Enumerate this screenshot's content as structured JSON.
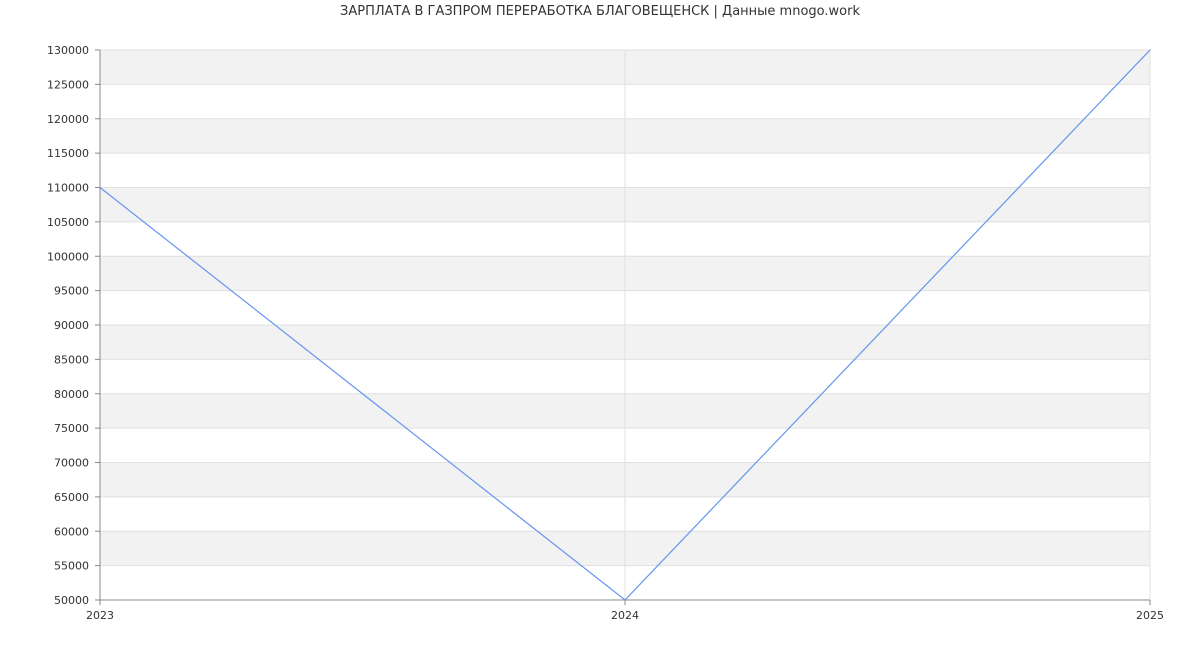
{
  "chart_data": {
    "type": "line",
    "title": "ЗАРПЛАТА В ГАЗПРОМ ПЕРЕРАБОТКА БЛАГОВЕЩЕНСК | Данные mnogo.work",
    "xlabel": "",
    "ylabel": "",
    "x": [
      "2023",
      "2024",
      "2025"
    ],
    "series": [
      {
        "values": [
          110000,
          50000,
          130000
        ]
      }
    ],
    "ylim": [
      50000,
      130000
    ],
    "y_ticks": [
      50000,
      55000,
      60000,
      65000,
      70000,
      75000,
      80000,
      85000,
      90000,
      95000,
      100000,
      105000,
      110000,
      115000,
      120000,
      125000,
      130000
    ],
    "grid": true,
    "colors": {
      "line": "#6495ed",
      "band": "#f2f2f2",
      "grid": "#e0e0e0",
      "axis": "#888888"
    }
  }
}
